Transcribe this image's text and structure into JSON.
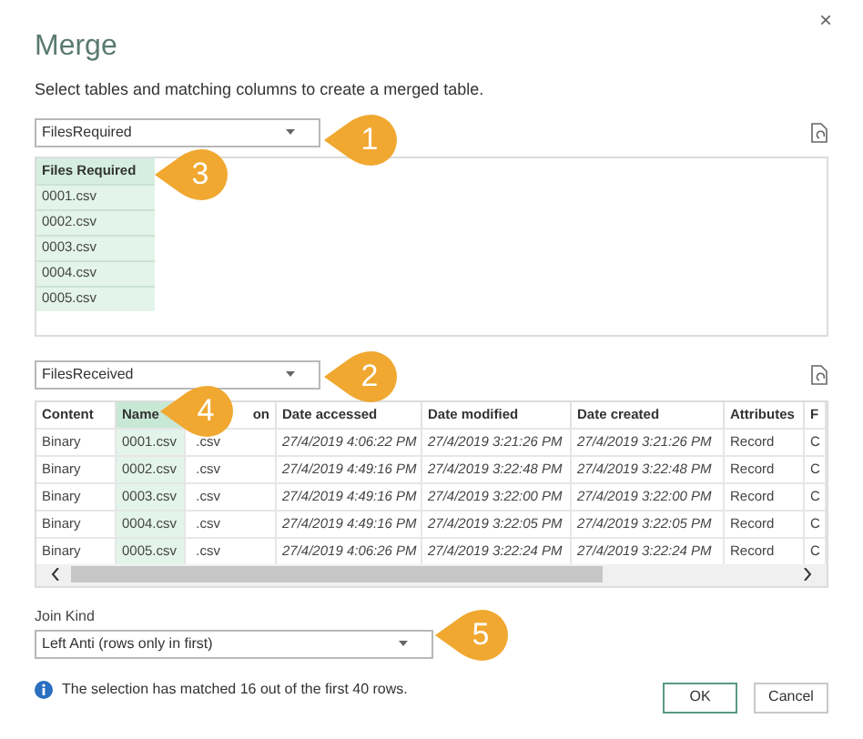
{
  "window": {
    "title": "Merge",
    "close": "×"
  },
  "description": "Select tables and matching columns to create a merged table.",
  "first_table": {
    "dropdown": "FilesRequired",
    "columns": [
      {
        "label": "Files Required",
        "selected": true
      }
    ],
    "rows": [
      [
        "0001.csv"
      ],
      [
        "0002.csv"
      ],
      [
        "0003.csv"
      ],
      [
        "0004.csv"
      ],
      [
        "0005.csv"
      ]
    ]
  },
  "second_table": {
    "dropdown": "FilesReceived",
    "columns": [
      {
        "label": "Content",
        "selected": false
      },
      {
        "label": "Name",
        "selected": true
      },
      {
        "label": "on",
        "selected": false
      },
      {
        "label": "Date accessed",
        "selected": false
      },
      {
        "label": "Date modified",
        "selected": false
      },
      {
        "label": "Date created",
        "selected": false
      },
      {
        "label": "Attributes",
        "selected": false
      },
      {
        "label": "F",
        "selected": false
      }
    ],
    "rows": [
      [
        "Binary",
        "0001.csv",
        ".csv",
        "27/4/2019 4:06:22 PM",
        "27/4/2019 3:21:26 PM",
        "27/4/2019 3:21:26 PM",
        "Record",
        "C"
      ],
      [
        "Binary",
        "0002.csv",
        ".csv",
        "27/4/2019 4:49:16 PM",
        "27/4/2019 3:22:48 PM",
        "27/4/2019 3:22:48 PM",
        "Record",
        "C"
      ],
      [
        "Binary",
        "0003.csv",
        ".csv",
        "27/4/2019 4:49:16 PM",
        "27/4/2019 3:22:00 PM",
        "27/4/2019 3:22:00 PM",
        "Record",
        "C"
      ],
      [
        "Binary",
        "0004.csv",
        ".csv",
        "27/4/2019 4:49:16 PM",
        "27/4/2019 3:22:05 PM",
        "27/4/2019 3:22:05 PM",
        "Record",
        "C"
      ],
      [
        "Binary",
        "0005.csv",
        ".csv",
        "27/4/2019 4:06:26 PM",
        "27/4/2019 3:22:24 PM",
        "27/4/2019 3:22:24 PM",
        "Record",
        "C"
      ]
    ]
  },
  "join_kind": {
    "label": "Join Kind",
    "value": "Left Anti (rows only in first)"
  },
  "status": "The selection has matched 16 out of the first 40 rows.",
  "buttons": [
    {
      "label": "OK",
      "default": true
    },
    {
      "label": "Cancel",
      "default": false
    }
  ],
  "callouts": [
    "1",
    "3",
    "2",
    "4",
    "5"
  ]
}
